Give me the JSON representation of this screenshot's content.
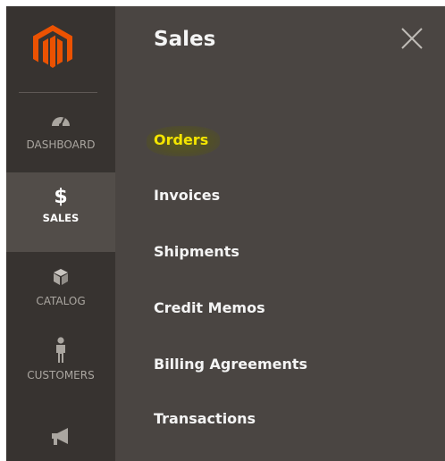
{
  "sidebar": {
    "items": [
      {
        "label": "DASHBOARD",
        "icon": "speedometer-icon",
        "active": false
      },
      {
        "label": "SALES",
        "icon": "dollar-icon",
        "symbol": "$",
        "active": true
      },
      {
        "label": "CATALOG",
        "icon": "box-icon",
        "active": false
      },
      {
        "label": "CUSTOMERS",
        "icon": "person-icon",
        "active": false
      },
      {
        "label": "",
        "icon": "megaphone-icon",
        "active": false
      }
    ]
  },
  "panel": {
    "title": "Sales",
    "close_icon": "close-icon",
    "links": [
      {
        "label": "Orders",
        "highlighted": true
      },
      {
        "label": "Invoices",
        "highlighted": false
      },
      {
        "label": "Shipments",
        "highlighted": false
      },
      {
        "label": "Credit Memos",
        "highlighted": false
      },
      {
        "label": "Billing Agreements",
        "highlighted": false
      },
      {
        "label": "Transactions",
        "highlighted": false
      }
    ]
  },
  "colors": {
    "sidebar_bg": "#373330",
    "panel_bg": "#4a4542",
    "active_item_bg": "#524d49",
    "logo_orange": "#eb5202",
    "highlight_text": "#f4e500",
    "text_light": "#f4f4f4",
    "text_muted": "#aaa6a0"
  }
}
